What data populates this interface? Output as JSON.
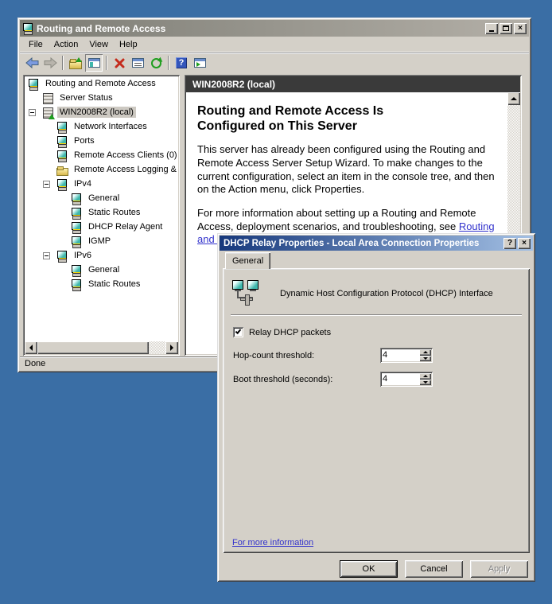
{
  "desktop": {
    "background_color": "#3A6EA5"
  },
  "mmc_window": {
    "title": "Routing and Remote Access",
    "menu_items": [
      "File",
      "Action",
      "View",
      "Help"
    ],
    "toolbar_icons": [
      "back-arrow-icon",
      "forward-arrow-icon",
      "up-one-level-icon",
      "show-console-tree-icon",
      "delete-icon",
      "properties-icon",
      "refresh-icon",
      "help-icon",
      "new-window-icon"
    ],
    "tree": {
      "items": [
        {
          "label": "Routing and Remote Access",
          "level": 0,
          "icon": "computer-icon"
        },
        {
          "label": "Server Status",
          "level": 1,
          "icon": "servers-icon"
        },
        {
          "label": "WIN2008R2 (local)",
          "level": 1,
          "icon": "server-green-icon",
          "expander": "minus",
          "selected": true
        },
        {
          "label": "Network Interfaces",
          "level": 2,
          "icon": "computer-icon"
        },
        {
          "label": "Ports",
          "level": 2,
          "icon": "computer-icon"
        },
        {
          "label": "Remote Access Clients (0)",
          "level": 2,
          "icon": "computer-icon"
        },
        {
          "label": "Remote Access Logging & P",
          "level": 2,
          "icon": "folder-icon"
        },
        {
          "label": "IPv4",
          "level": 2,
          "icon": "computer-icon",
          "expander": "minus"
        },
        {
          "label": "General",
          "level": 3,
          "icon": "computer-icon"
        },
        {
          "label": "Static Routes",
          "level": 3,
          "icon": "computer-icon"
        },
        {
          "label": "DHCP Relay Agent",
          "level": 3,
          "icon": "computer-icon"
        },
        {
          "label": "IGMP",
          "level": 3,
          "icon": "computer-icon"
        },
        {
          "label": "IPv6",
          "level": 2,
          "icon": "computer-icon",
          "expander": "minus"
        },
        {
          "label": "General",
          "level": 3,
          "icon": "computer-icon"
        },
        {
          "label": "Static Routes",
          "level": 3,
          "icon": "computer-icon"
        }
      ]
    },
    "result_pane": {
      "header": "WIN2008R2 (local)",
      "heading_line1": "Routing and Remote Access Is",
      "heading_line2": "Configured on This Server",
      "paragraph1": "This server has already been configured using the Routing and Remote Access Server Setup Wizard. To make changes to the current configuration, select an item in the console tree, and then on the Action menu, click Properties.",
      "paragraph2_text": "For more information about setting up a Routing and Remote Access, deployment scenarios, and troubleshooting, see ",
      "paragraph2_link": "Routing and Remote Access Help",
      "paragraph2_end": "."
    },
    "status_bar": "Done"
  },
  "dialog": {
    "title": "DHCP Relay Properties - Local Area Connection Properties",
    "tab_label": "General",
    "interface_caption": "Dynamic Host Configuration Protocol (DHCP) Interface",
    "relay_checkbox": {
      "label": "Relay DHCP packets",
      "checked": true
    },
    "hop_count": {
      "label": "Hop-count threshold:",
      "value": "4"
    },
    "boot_threshold": {
      "label": "Boot threshold (seconds):",
      "value": "4"
    },
    "more_info_link": "For more information",
    "buttons": {
      "ok": "OK",
      "cancel": "Cancel",
      "apply": "Apply"
    },
    "apply_disabled": true
  },
  "colors": {
    "desktop": "#3A6EA5",
    "window_face": "#D4D0C8",
    "active_title_gradient": [
      "#16387C",
      "#A3C0E4"
    ],
    "inactive_title_gradient": [
      "#7C7C74",
      "#B3AFA7"
    ],
    "result_header_bg": "#3A3A3A",
    "link": "#3333CC",
    "selection_bg": "#CDC9C2"
  }
}
